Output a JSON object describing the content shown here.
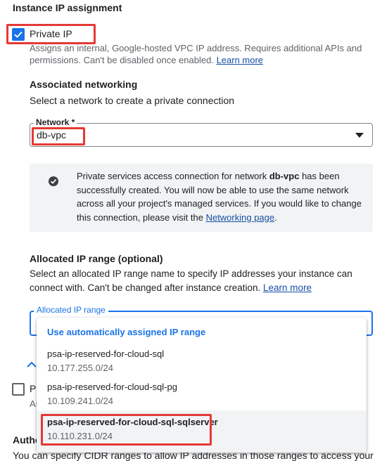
{
  "header": {
    "title": "Instance IP assignment"
  },
  "private_ip": {
    "label": "Private IP",
    "checked": true,
    "description_1": "Assigns an internal, Google-hosted VPC IP address. Requires additional APIs and",
    "description_2": "permissions. Can't be disabled once enabled.",
    "learn_more": "Learn more"
  },
  "networking": {
    "title": "Associated networking",
    "subtitle": "Select a network to create a private connection",
    "network_label": "Network *",
    "network_value": "db-vpc"
  },
  "info": {
    "line1_pre": "Private services access connection for network ",
    "line1_bold": "db-vpc",
    "line1_post": " has been",
    "line2": "successfully created. You will now be able to use the same network",
    "line3": "across all your project's managed services. If you would like to change",
    "line4_pre": "this connection, please visit the ",
    "line4_link": "Networking page",
    "line4_post": "."
  },
  "allocated": {
    "title": "Allocated IP range (optional)",
    "desc_1": "Select an allocated IP range name to specify IP addresses your instance can",
    "desc_2_pre": "connect with. Can't be changed after instance creation. ",
    "learn_more": "Learn more",
    "field_label": "Allocated IP range",
    "menu": {
      "auto_option": "Use automatically assigned IP range",
      "options": [
        {
          "name": "psa-ip-reserved-for-cloud-sql",
          "range": "10.177.255.0/24"
        },
        {
          "name": "psa-ip-reserved-for-cloud-sql-pg",
          "range": "10.109.241.0/24"
        },
        {
          "name": "psa-ip-reserved-for-cloud-sql-sqlserver",
          "range": "10.110.231.0/24"
        }
      ]
    }
  },
  "behind": {
    "checkbox_label_fragment": "P",
    "hint_fragment": "As",
    "bottom_title_fragment": "Autho",
    "bottom_text": "You can specify CIDR ranges to allow IP addresses in those ranges to access your"
  },
  "colors": {
    "accent": "#1a73e8",
    "highlight": "#e53935"
  }
}
